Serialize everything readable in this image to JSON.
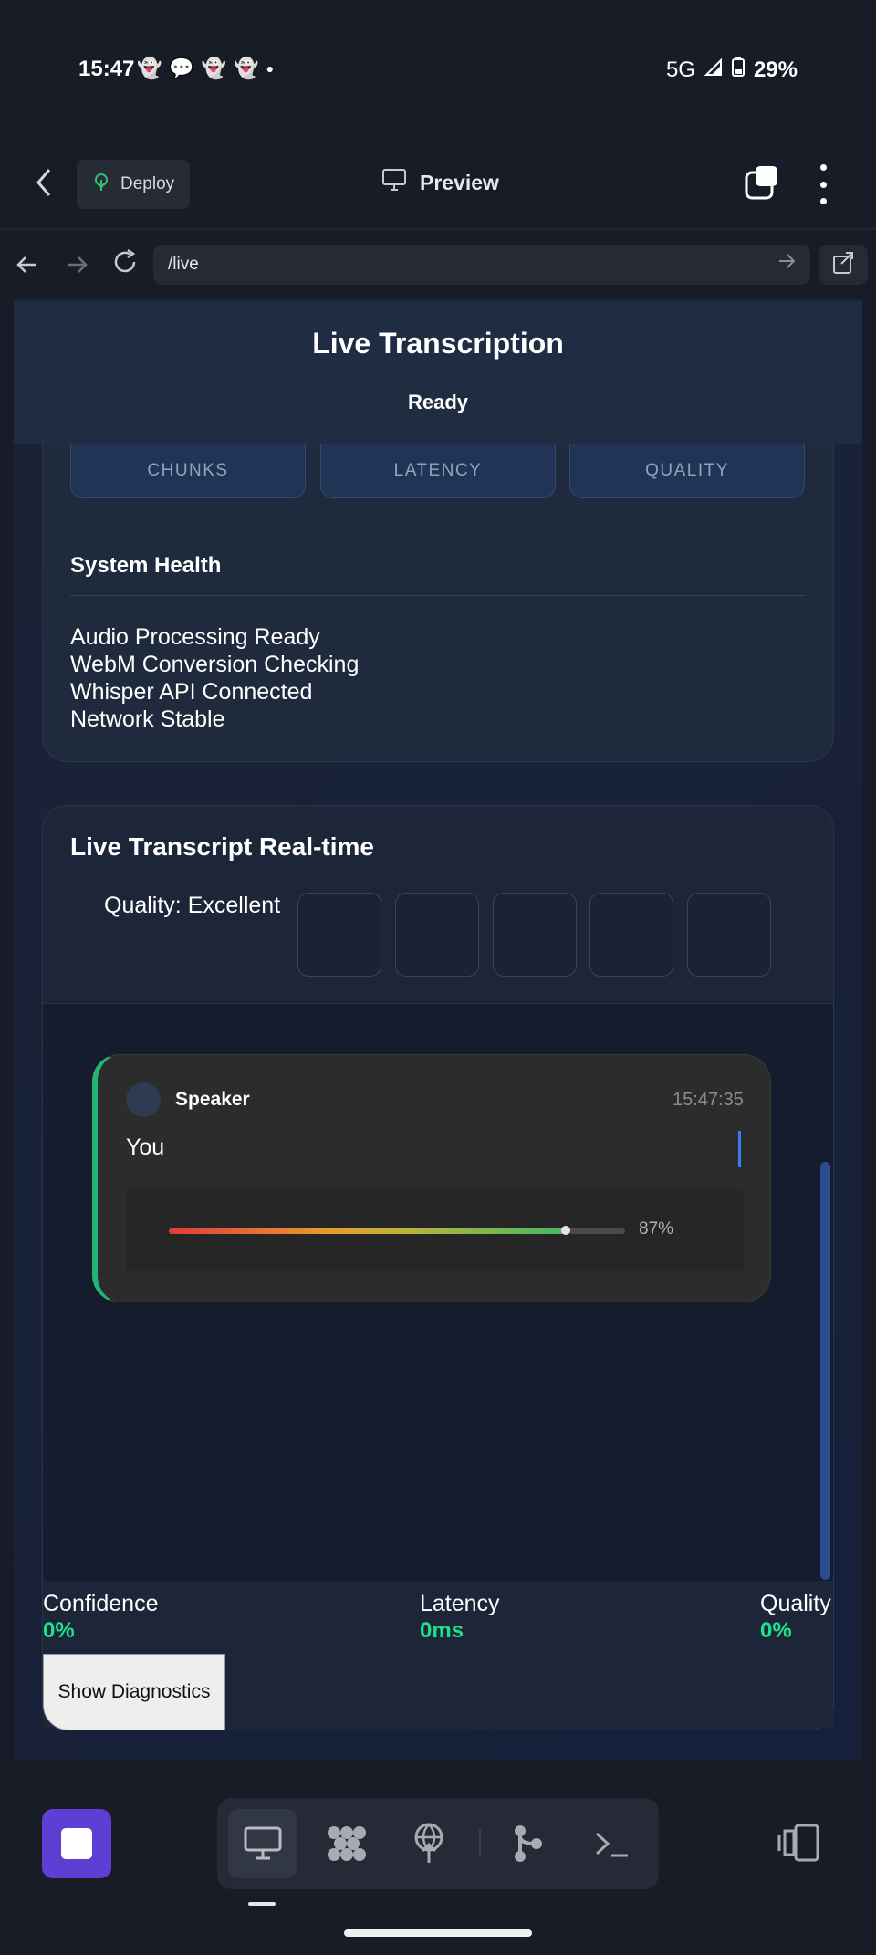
{
  "status_bar": {
    "time": "15:47",
    "network": "5G",
    "battery": "29%",
    "notification_icons": [
      "snapchat-icon",
      "chat-icon",
      "snapchat-icon",
      "snapchat-icon",
      "dot-icon"
    ]
  },
  "app_header": {
    "deploy_label": "Deploy",
    "preview_label": "Preview"
  },
  "browser": {
    "url": "/live"
  },
  "page": {
    "title": "Live Transcription",
    "status": "Ready",
    "metrics": [
      "CHUNKS",
      "LATENCY",
      "QUALITY"
    ],
    "system_health": {
      "title": "System Health",
      "items": [
        "Audio Processing Ready",
        "WebM Conversion Checking",
        "Whisper API Connected",
        "Network Stable"
      ]
    },
    "transcript": {
      "title": "Live Transcript Real-time",
      "quality_label": "Quality: Excellent",
      "message": {
        "speaker": "Speaker",
        "time": "15:47:35",
        "text": "You",
        "confidence": 0.87,
        "confidence_label": "87%"
      }
    },
    "stats": {
      "confidence_label": "Confidence",
      "confidence_value": "0%",
      "latency_label": "Latency",
      "latency_value": "0ms",
      "quality_label": "Quality",
      "quality_value": "0%"
    },
    "diagnostics_button": "Show Diagnostics"
  },
  "colors": {
    "accent_green": "#1fe08a",
    "message_border": "#22b573",
    "stop_button": "#5d3fd3",
    "caret": "#3d7bef"
  }
}
